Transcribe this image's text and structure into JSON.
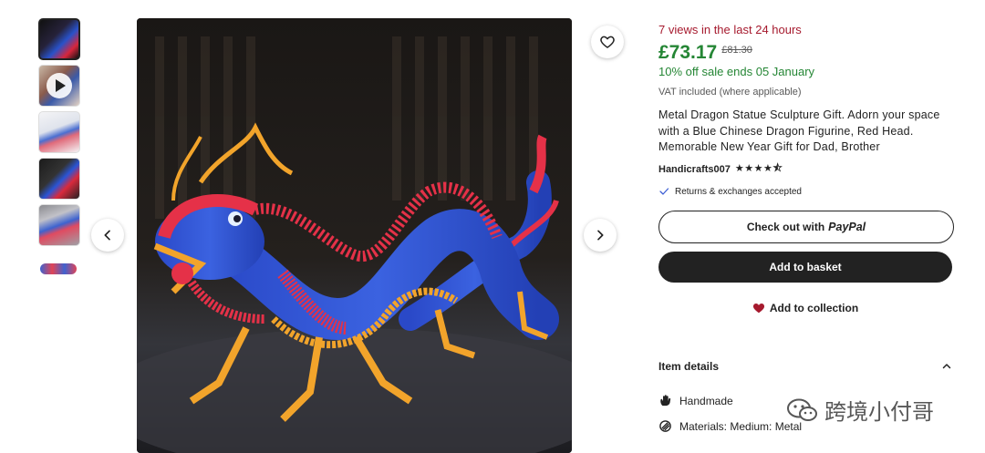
{
  "gallery": {
    "thumbnails": [
      {
        "name": "thumbnail-1",
        "active": true
      },
      {
        "name": "thumbnail-2-video",
        "video": true
      },
      {
        "name": "thumbnail-3"
      },
      {
        "name": "thumbnail-4"
      },
      {
        "name": "thumbnail-5"
      },
      {
        "name": "thumbnail-6"
      }
    ],
    "favorite_icon": "heart-outline-icon",
    "prev_icon": "chevron-left-icon",
    "next_icon": "chevron-right-icon"
  },
  "listing": {
    "views_text": "7 views in the last 24 hours",
    "price": "£73.17",
    "original_price": "£81.30",
    "sale_text": "10% off sale ends 05 January",
    "vat_text": "VAT included (where applicable)",
    "title": "Metal Dragon Statue Sculpture Gift. Adorn your space with a Blue Chinese Dragon Figurine, Red Head. Memorable New Year Gift for Dad, Brother",
    "shop_name": "Handicrafts007",
    "rating": 4.5,
    "rating_stars": "★★★★⯪",
    "returns_text": "Returns & exchanges accepted",
    "checkout_prefix": "Check out with",
    "checkout_brand": "PayPal",
    "add_to_basket": "Add to basket",
    "add_to_collection": "Add to collection"
  },
  "item_details": {
    "heading": "Item details",
    "rows": [
      {
        "label": "Handmade",
        "icon": "hand-icon"
      },
      {
        "label": "Materials: Medium: Metal",
        "icon": "materials-icon"
      }
    ]
  },
  "watermark": {
    "text": "跨境小付哥"
  },
  "colors": {
    "views": "#a61a2e",
    "price": "#258635",
    "button_dark": "#222222",
    "heart": "#a61a2e"
  }
}
